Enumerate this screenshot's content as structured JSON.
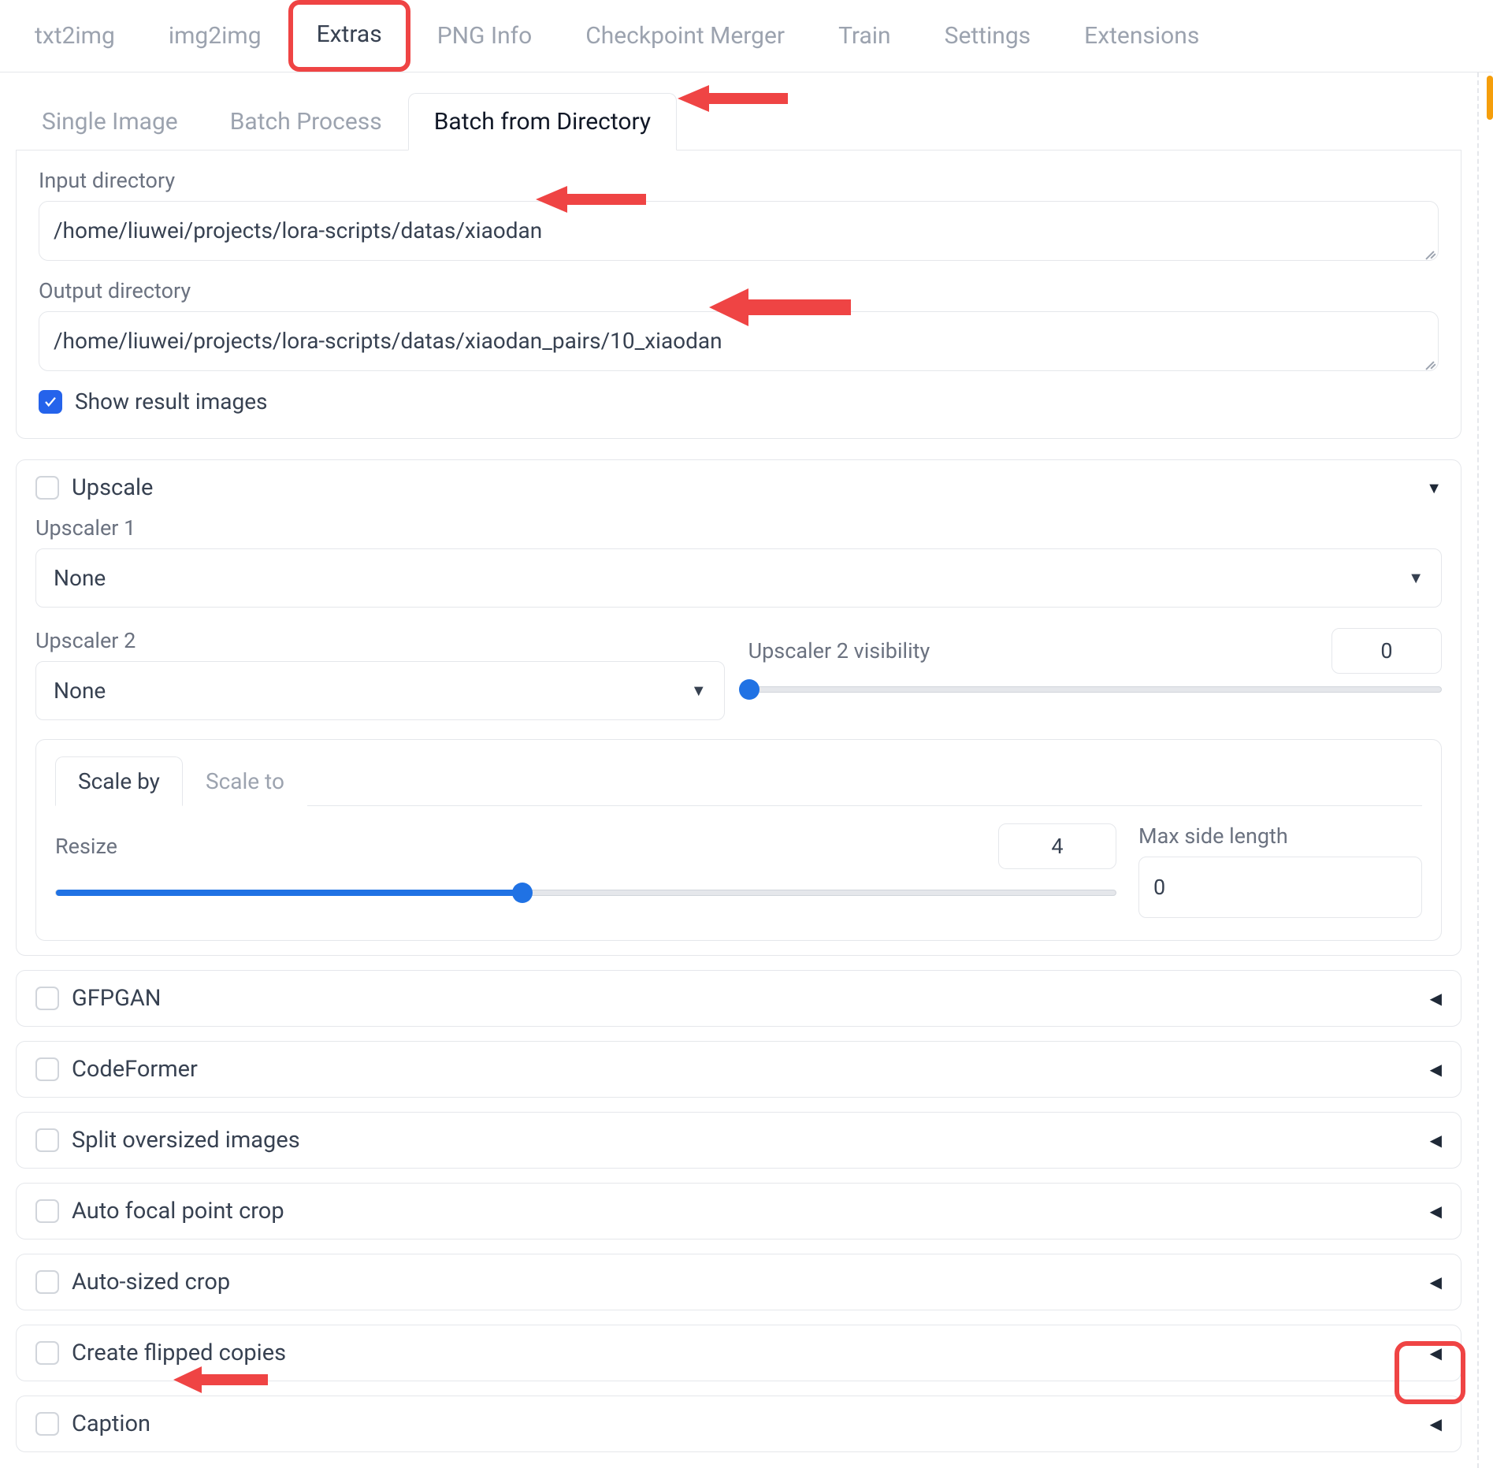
{
  "main_tabs": {
    "txt2img": "txt2img",
    "img2img": "img2img",
    "extras": "Extras",
    "png_info": "PNG Info",
    "checkpoint_merger": "Checkpoint Merger",
    "train": "Train",
    "settings": "Settings",
    "extensions": "Extensions"
  },
  "sub_tabs": {
    "single_image": "Single Image",
    "batch_process": "Batch Process",
    "batch_from_directory": "Batch from Directory"
  },
  "fields": {
    "input_dir_label": "Input directory",
    "input_dir_value": "/home/liuwei/projects/lora-scripts/datas/xiaodan",
    "output_dir_label": "Output directory",
    "output_dir_value": "/home/liuwei/projects/lora-scripts/datas/xiaodan_pairs/10_xiaodan",
    "show_result_label": "Show result images",
    "show_result_checked": true
  },
  "upscale": {
    "title": "Upscale",
    "upscaler1_label": "Upscaler 1",
    "upscaler1_value": "None",
    "upscaler2_label": "Upscaler 2",
    "upscaler2_value": "None",
    "upscaler2_vis_label": "Upscaler 2 visibility",
    "upscaler2_vis_value": "0",
    "scale_by_tab": "Scale by",
    "scale_to_tab": "Scale to",
    "resize_label": "Resize",
    "resize_value": "4",
    "max_side_label": "Max side length",
    "max_side_value": "0"
  },
  "sections": {
    "gfpgan": "GFPGAN",
    "codeformer": "CodeFormer",
    "split": "Split oversized images",
    "autofocal": "Auto focal point crop",
    "autosized": "Auto-sized crop",
    "flipped": "Create flipped copies",
    "caption": "Caption"
  }
}
